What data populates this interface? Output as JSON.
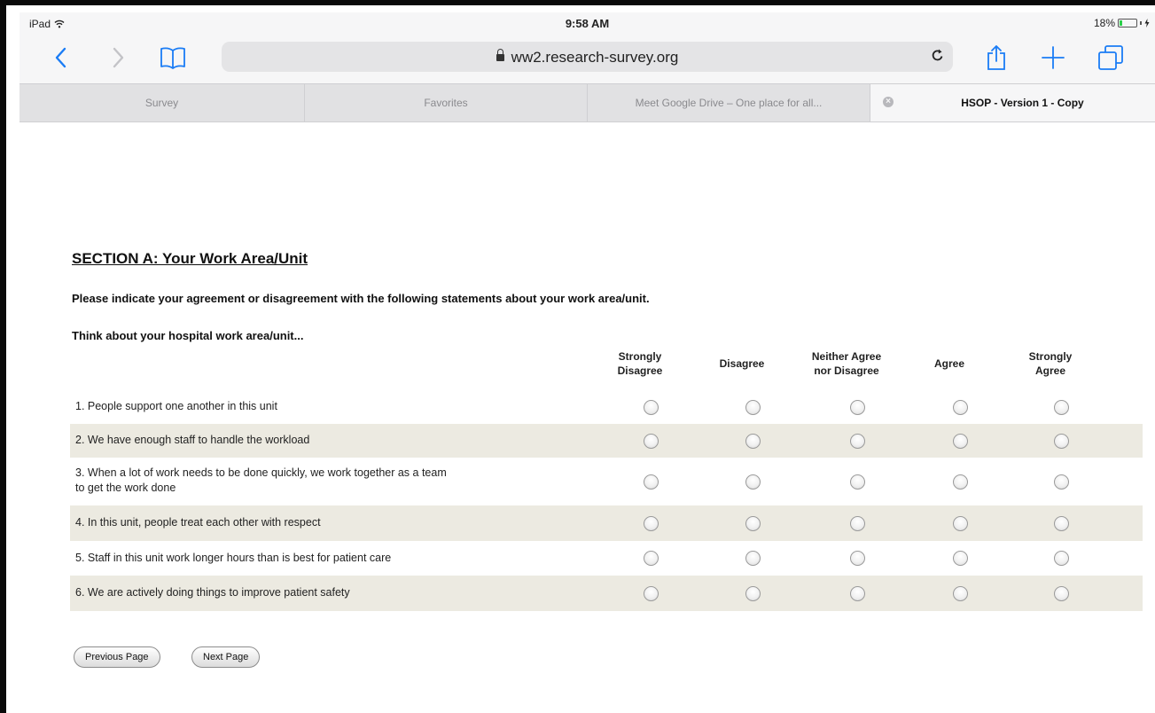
{
  "status_bar": {
    "device": "iPad",
    "time": "9:58 AM",
    "battery_percent": "18%",
    "battery_level": 0.18
  },
  "toolbar": {
    "url": "ww2.research-survey.org",
    "icons": [
      "back-icon",
      "forward-icon",
      "bookmarks-icon",
      "lock-icon",
      "reload-icon",
      "share-icon",
      "new-tab-icon",
      "tabs-icon"
    ]
  },
  "tabs": [
    {
      "label": "Survey",
      "active": false
    },
    {
      "label": "Favorites",
      "active": false
    },
    {
      "label": "Meet Google Drive – One place for all...",
      "active": false
    },
    {
      "label": "HSOP - Version 1 - Copy",
      "active": true
    }
  ],
  "section": {
    "title": "SECTION A: Your Work Area/Unit",
    "instruction": "Please indicate your agreement or disagreement with the following statements about your work area/unit.",
    "prompt": "Think about your hospital work area/unit..."
  },
  "columns": [
    {
      "line1": "Strongly",
      "line2": "Disagree"
    },
    {
      "line1": "Disagree",
      "line2": ""
    },
    {
      "line1": "Neither Agree",
      "line2": "nor Disagree"
    },
    {
      "line1": "Agree",
      "line2": ""
    },
    {
      "line1": "Strongly",
      "line2": "Agree"
    }
  ],
  "questions": [
    {
      "line1": "1. People support one another in this unit",
      "line2": ""
    },
    {
      "line1": "2. We have enough staff to handle the workload",
      "line2": ""
    },
    {
      "line1": "3. When a lot of work needs to be done quickly, we work together as a team",
      "line2": "to get the work done"
    },
    {
      "line1": "4. In this unit, people treat each other with respect",
      "line2": ""
    },
    {
      "line1": "5. Staff in this unit work longer hours than is best for patient care",
      "line2": ""
    },
    {
      "line1": "6. We are actively doing things to improve patient safety",
      "line2": ""
    }
  ],
  "buttons": {
    "previous": "Previous Page",
    "next": "Next Page"
  },
  "colors": {
    "shaded_row": "#eceae1",
    "ios_blue": "#1a7cf5"
  }
}
